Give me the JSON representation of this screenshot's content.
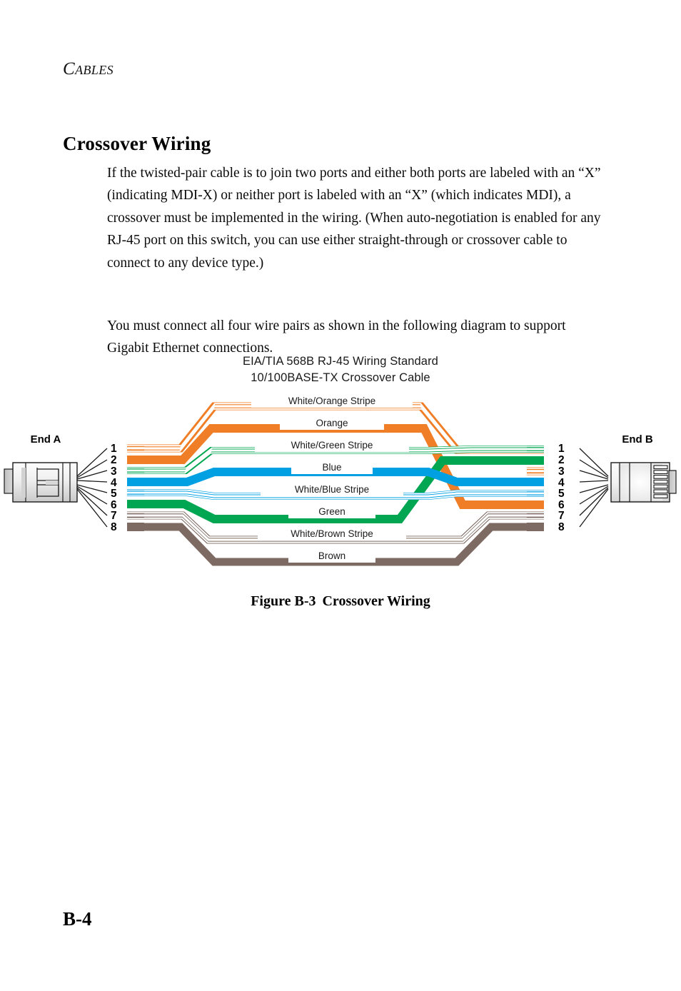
{
  "page": {
    "running_head": "CABLES",
    "running_head_first": "C",
    "running_head_rest": "ABLES",
    "folio": "B-4"
  },
  "section": {
    "heading": "Crossover Wiring",
    "paragraphs": [
      "If the twisted-pair cable is to join two ports and either both ports are labeled with an “X” (indicating MDI-X) or neither port is labeled with an “X” (which indicates MDI), a crossover must be implemented in the wiring. (When auto-negotiation is enabled for any RJ-45 port on this switch, you can use either straight-through or crossover cable to connect to any device type.)",
      "You must connect all four wire pairs as shown in the following diagram to support Gigabit Ethernet connections."
    ]
  },
  "figure": {
    "title_line1": "EIA/TIA 568B RJ-45 Wiring Standard",
    "title_line2": "10/100BASE-TX Crossover Cable",
    "caption_number": "Figure B-3",
    "caption_text": "Crossover Wiring",
    "end_a_label": "End A",
    "end_b_label": "End B",
    "pin_numbers": [
      "1",
      "2",
      "3",
      "4",
      "5",
      "6",
      "7",
      "8"
    ],
    "wire_labels": [
      "White/Orange Stripe",
      "Orange",
      "White/Green Stripe",
      "Blue",
      "White/Blue Stripe",
      "Green",
      "White/Brown Stripe",
      "Brown"
    ],
    "colors": {
      "orange": "#F07E26",
      "green": "#00A651",
      "blue": "#00A0E3",
      "brown": "#7D6A62",
      "white": "#FFFFFF",
      "connector_outline": "#1a1a1a",
      "connector_fill": "#E8E8E8",
      "leader_line": "#1a1a1a",
      "text": "#1a1a1a"
    },
    "end_a_pin_assignments": [
      {
        "pin": "1",
        "wire": "White/Orange Stripe"
      },
      {
        "pin": "2",
        "wire": "Orange"
      },
      {
        "pin": "3",
        "wire": "White/Green Stripe"
      },
      {
        "pin": "4",
        "wire": "Blue"
      },
      {
        "pin": "5",
        "wire": "White/Blue Stripe"
      },
      {
        "pin": "6",
        "wire": "Green"
      },
      {
        "pin": "7",
        "wire": "White/Brown Stripe"
      },
      {
        "pin": "8",
        "wire": "Brown"
      }
    ],
    "end_b_pin_assignments": [
      {
        "pin": "1",
        "wire": "White/Green Stripe"
      },
      {
        "pin": "2",
        "wire": "Green"
      },
      {
        "pin": "3",
        "wire": "White/Orange Stripe"
      },
      {
        "pin": "4",
        "wire": "Blue"
      },
      {
        "pin": "5",
        "wire": "White/Blue Stripe"
      },
      {
        "pin": "6",
        "wire": "Orange"
      },
      {
        "pin": "7",
        "wire": "White/Brown Stripe"
      },
      {
        "pin": "8",
        "wire": "Brown"
      }
    ]
  }
}
